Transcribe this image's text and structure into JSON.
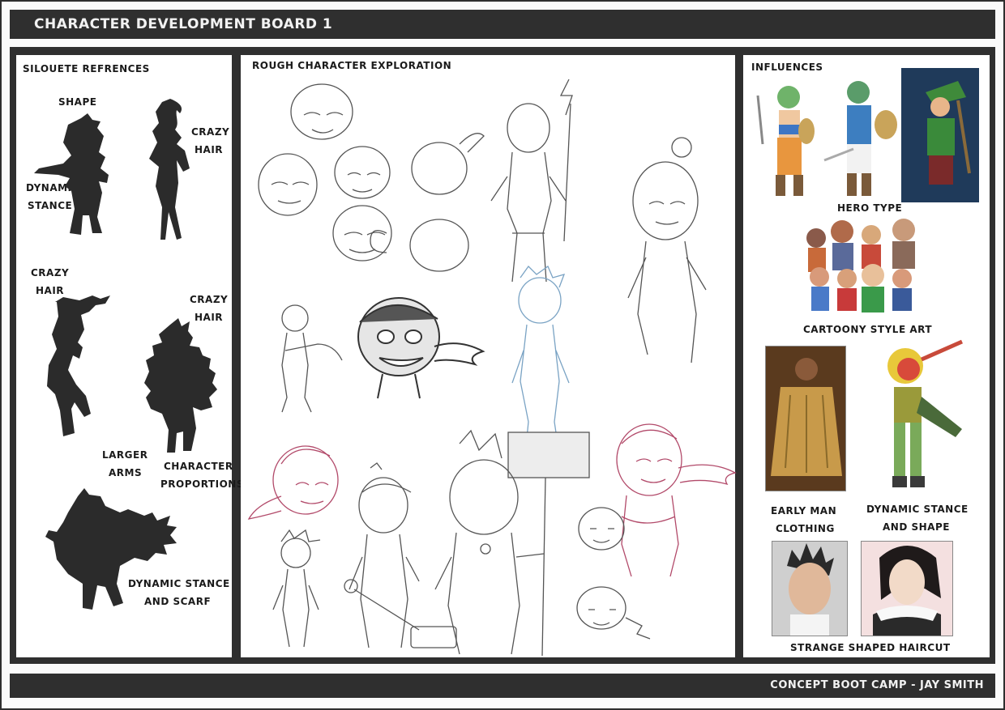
{
  "header": {
    "title": "CHARACTER DEVELOPMENT BOARD 1"
  },
  "footer": {
    "credit": "CONCEPT BOOT CAMP - JAY SMITH"
  },
  "silhouettes": {
    "title": "SILOUETE REFRENCES",
    "labels": {
      "shape": "SHAPE",
      "dynamic_stance_1": "DYNAMIC",
      "dynamic_stance_2": "STANCE",
      "crazy_hair_a1": "CRAZY",
      "crazy_hair_a2": "HAIR",
      "crazy_hair_b1": "CRAZY",
      "crazy_hair_b2": "HAIR",
      "crazy_hair_c1": "CRAZY",
      "crazy_hair_c2": "HAIR",
      "larger_arms_1": "LARGER",
      "larger_arms_2": "ARMS",
      "proportions_1": "CHARACTER",
      "proportions_2": "PROPORTIONS",
      "scarf_1": "DYNAMIC STANCE",
      "scarf_2": "AND SCARF"
    }
  },
  "exploration": {
    "title": "ROUGH CHARACTER EXPLORATION"
  },
  "influences": {
    "title": "INFLUENCES",
    "labels": {
      "hero_type": "HERO TYPE",
      "cartoony": "CARTOONY STYLE ART",
      "early_man_1": "EARLY MAN",
      "early_man_2": "CLOTHING",
      "dyn_shape_1": "DYNAMIC STANCE",
      "dyn_shape_2": "AND SHAPE",
      "haircut": "STRANGE SHAPED HAIRCUT"
    }
  },
  "colors": {
    "frame": "#2f2f2f",
    "silhouette": "#2b2b2b",
    "sketch": "#555555",
    "sketch_red": "#b24a6a",
    "sketch_blue": "#7aa3c4"
  }
}
